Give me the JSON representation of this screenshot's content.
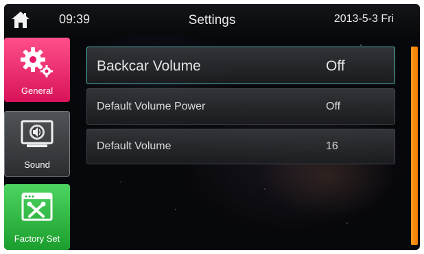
{
  "header": {
    "time": "09:39",
    "title": "Settings",
    "date": "2013-5-3 Fri"
  },
  "sidebar": {
    "items": [
      {
        "label": "General",
        "icon": "gears-icon",
        "color": "#e8196a",
        "active": true
      },
      {
        "label": "Sound",
        "icon": "speaker-monitor-icon",
        "color": "#3a3c40",
        "active": false
      },
      {
        "label": "Factory Set",
        "icon": "tools-window-icon",
        "color": "#2bb53c",
        "active": false
      }
    ]
  },
  "settings": {
    "rows": [
      {
        "label": "Backcar Volume",
        "value": "Off",
        "selected": true
      },
      {
        "label": "Default Volume Power",
        "value": "Off",
        "selected": false
      },
      {
        "label": "Default Volume",
        "value": "16",
        "selected": false
      }
    ]
  },
  "colors": {
    "accent_scrollbar": "#f5850d",
    "selected_border": "#4fb8b0"
  }
}
